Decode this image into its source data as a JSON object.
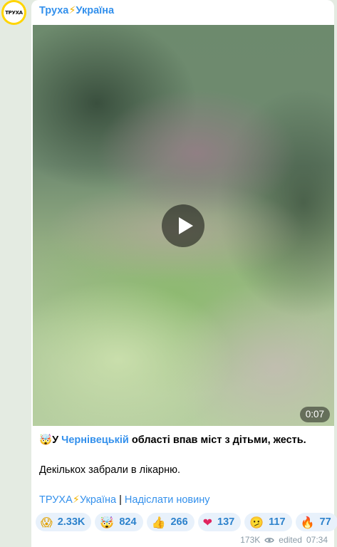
{
  "channel": {
    "name_part1": "Труха",
    "name_bolt": "⚡",
    "name_part2": "Україна",
    "avatar_text": "ТРУХА"
  },
  "video": {
    "duration": "0:07"
  },
  "message": {
    "line1_emoji": "🤯",
    "line1_prefix": "У ",
    "line1_link": "Чернівецькій",
    "line1_suffix": " області впав міст з дітьми, жесть.",
    "line2": "Декількох забрали в лікарню."
  },
  "footer_links": {
    "channel_part1": "ТРУХА",
    "channel_bolt": "⚡",
    "channel_part2": "Україна",
    "separator": " | ",
    "submit_news": "Надіслати новину"
  },
  "reactions": [
    {
      "emoji": "😱",
      "count": "2.33K"
    },
    {
      "emoji": "🤯",
      "count": "824"
    },
    {
      "emoji": "👍",
      "count": "266"
    },
    {
      "emoji": "❤",
      "count": "137"
    },
    {
      "emoji": "🫤",
      "count": "117"
    },
    {
      "emoji": "🔥",
      "count": "77"
    }
  ],
  "meta": {
    "views": "173K",
    "edited": "edited",
    "time": "07:34"
  }
}
